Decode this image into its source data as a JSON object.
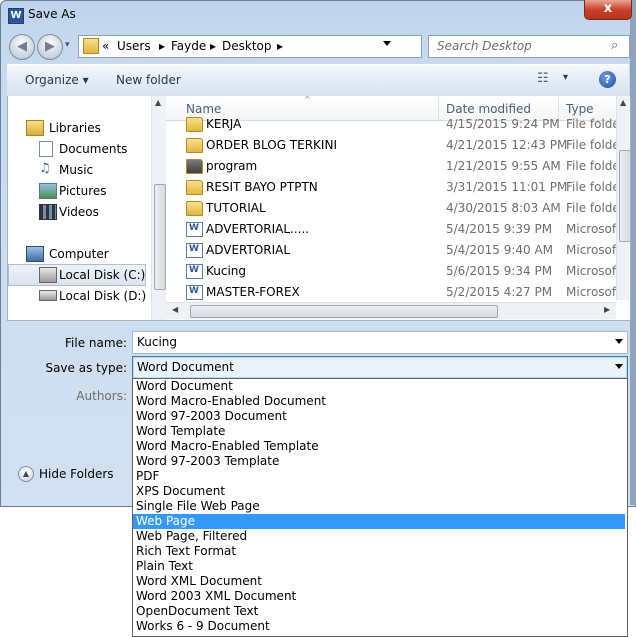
{
  "window": {
    "title": "Save As",
    "close_label": "x",
    "app_icon": "W"
  },
  "address": {
    "path_prefix": "«",
    "crumbs": [
      "Users",
      "Fayde",
      "Desktop"
    ]
  },
  "search": {
    "placeholder": "Search Desktop"
  },
  "toolbar": {
    "organize_label": "Organize ▾",
    "new_folder_label": "New folder",
    "help_label": "?"
  },
  "nav": {
    "items": [
      {
        "label": "Libraries",
        "icon": "libraries-icon"
      },
      {
        "label": "Documents",
        "icon": "documents-icon"
      },
      {
        "label": "Music",
        "icon": "music-icon"
      },
      {
        "label": "Pictures",
        "icon": "pictures-icon"
      },
      {
        "label": "Videos",
        "icon": "videos-icon"
      },
      {
        "label": "Computer",
        "icon": "computer-icon"
      },
      {
        "label": "Local Disk (C:)",
        "icon": "disk-icon",
        "selected": true
      },
      {
        "label": "Local Disk (D:)",
        "icon": "disk-icon"
      }
    ]
  },
  "file_list": {
    "columns": {
      "name": "Name",
      "date": "Date modified",
      "type": "Type"
    },
    "rows": [
      {
        "name": "KERJA",
        "date": "4/15/2015 9:24 PM",
        "type": "File folde",
        "kind": "folder"
      },
      {
        "name": "ORDER BLOG TERKINI",
        "date": "4/21/2015 12:43 PM",
        "type": "File folde",
        "kind": "folder"
      },
      {
        "name": "program",
        "date": "1/21/2015 9:55 AM",
        "type": "File folde",
        "kind": "folder-dark"
      },
      {
        "name": "RESIT BAYO PTPTN",
        "date": "3/31/2015 11:01 PM",
        "type": "File folde",
        "kind": "folder"
      },
      {
        "name": "TUTORIAL",
        "date": "4/30/2015 8:03 AM",
        "type": "File folde",
        "kind": "folder"
      },
      {
        "name": "ADVERTORIAL.....",
        "date": "5/4/2015 9:39 PM",
        "type": "Microsoft",
        "kind": "word"
      },
      {
        "name": "ADVERTORIAL",
        "date": "5/4/2015 9:40 AM",
        "type": "Microsoft",
        "kind": "word"
      },
      {
        "name": "Kucing",
        "date": "5/6/2015 9:34 PM",
        "type": "Microsoft",
        "kind": "word"
      },
      {
        "name": "MASTER-FOREX",
        "date": "5/2/2015 4:27 PM",
        "type": "Microsoft",
        "kind": "word"
      }
    ]
  },
  "form": {
    "file_name_label": "File name:",
    "file_name_value": "Kucing",
    "save_type_label": "Save as type:",
    "save_type_value": "Word Document",
    "authors_label": "Authors:",
    "hide_folders_label": "Hide Folders"
  },
  "save_type_options": [
    "Word Document",
    "Word Macro-Enabled Document",
    "Word 97-2003 Document",
    "Word Template",
    "Word Macro-Enabled Template",
    "Word 97-2003 Template",
    "PDF",
    "XPS Document",
    "Single File Web Page",
    "Web Page",
    "Web Page, Filtered",
    "Rich Text Format",
    "Plain Text",
    "Word XML Document",
    "Word 2003 XML Document",
    "OpenDocument Text",
    "Works 6 - 9 Document"
  ],
  "selected_option": "Web Page"
}
